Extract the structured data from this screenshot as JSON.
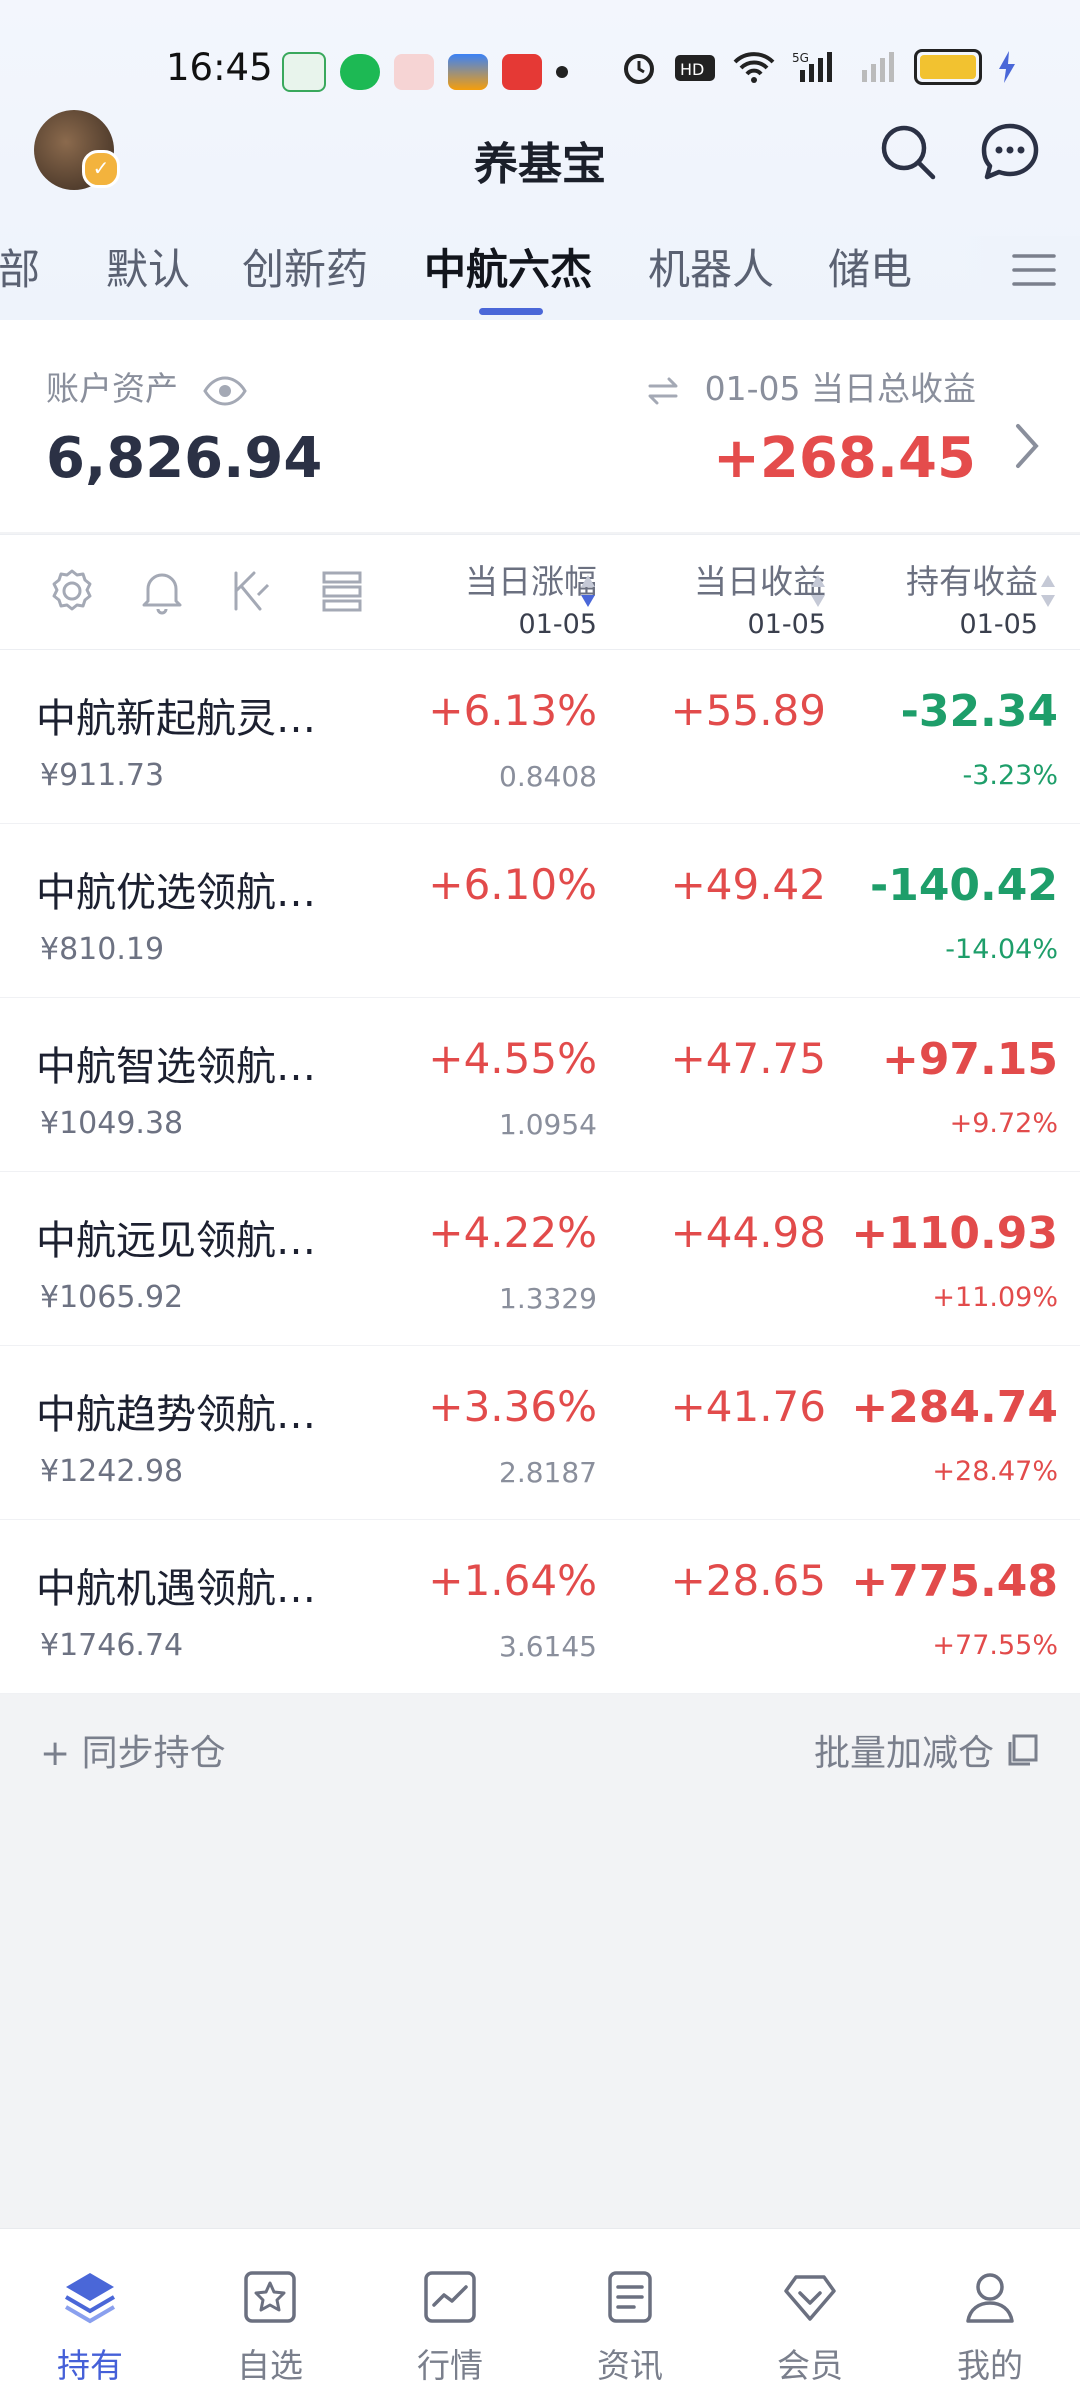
{
  "status_bar": {
    "time": "16:45"
  },
  "header": {
    "title": "养基宝"
  },
  "tabs": [
    {
      "label": "全部",
      "active": false
    },
    {
      "label": "默认",
      "active": false
    },
    {
      "label": "创新药",
      "active": false
    },
    {
      "label": "中航六杰",
      "active": true
    },
    {
      "label": "机器人",
      "active": false
    },
    {
      "label": "储电",
      "active": false
    }
  ],
  "account": {
    "label": "账户资产",
    "value": "6,826.94",
    "profit_label": "01-05 当日总收益",
    "profit_value": "+268.45"
  },
  "table_header": {
    "col1": {
      "label": "当日涨幅",
      "date": "01-05"
    },
    "col2": {
      "label": "当日收益",
      "date": "01-05"
    },
    "col3": {
      "label": "持有收益",
      "date": "01-05"
    }
  },
  "funds": [
    {
      "name": "中航新起航灵…",
      "amount": "¥911.73",
      "change": "+6.13%",
      "nav": "0.8408",
      "day_profit": "+55.89",
      "hold_profit": "-32.34",
      "hold_pct": "-3.23%",
      "hold_dir": "down"
    },
    {
      "name": "中航优选领航…",
      "amount": "¥810.19",
      "change": "+6.10%",
      "nav": "",
      "day_profit": "+49.42",
      "hold_profit": "-140.42",
      "hold_pct": "-14.04%",
      "hold_dir": "down"
    },
    {
      "name": "中航智选领航…",
      "amount": "¥1049.38",
      "change": "+4.55%",
      "nav": "1.0954",
      "day_profit": "+47.75",
      "hold_profit": "+97.15",
      "hold_pct": "+9.72%",
      "hold_dir": "up"
    },
    {
      "name": "中航远见领航…",
      "amount": "¥1065.92",
      "change": "+4.22%",
      "nav": "1.3329",
      "day_profit": "+44.98",
      "hold_profit": "+110.93",
      "hold_pct": "+11.09%",
      "hold_dir": "up"
    },
    {
      "name": "中航趋势领航…",
      "amount": "¥1242.98",
      "change": "+3.36%",
      "nav": "2.8187",
      "day_profit": "+41.76",
      "hold_profit": "+284.74",
      "hold_pct": "+28.47%",
      "hold_dir": "up"
    },
    {
      "name": "中航机遇领航…",
      "amount": "¥1746.74",
      "change": "+1.64%",
      "nav": "3.6145",
      "day_profit": "+28.65",
      "hold_profit": "+775.48",
      "hold_pct": "+77.55%",
      "hold_dir": "up"
    }
  ],
  "actions": {
    "sync": "+ 同步持仓",
    "batch": "批量加减仓"
  },
  "bottom_nav": [
    {
      "label": "持有",
      "icon": "layers-icon",
      "active": true
    },
    {
      "label": "自选",
      "icon": "star-icon",
      "active": false
    },
    {
      "label": "行情",
      "icon": "chart-icon",
      "active": false
    },
    {
      "label": "资讯",
      "icon": "news-icon",
      "active": false
    },
    {
      "label": "会员",
      "icon": "diamond-icon",
      "active": false
    },
    {
      "label": "我的",
      "icon": "person-icon",
      "active": false
    }
  ],
  "colors": {
    "accent": "#4a67d8",
    "up": "#e24b4b",
    "down": "#1e9e6a"
  }
}
